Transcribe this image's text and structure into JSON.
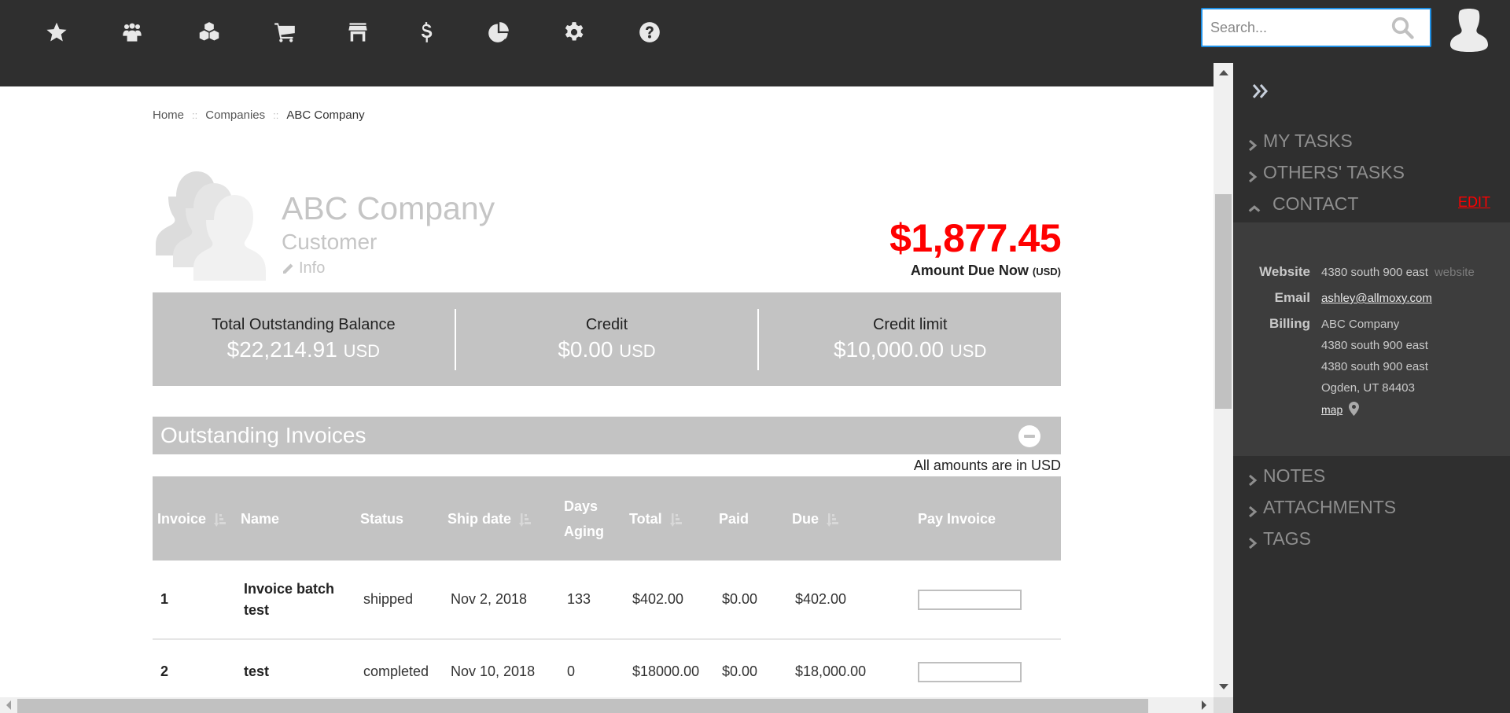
{
  "topnav": {
    "icons": [
      {
        "name": "favorites",
        "icon": "star-icon"
      },
      {
        "name": "companies",
        "icon": "users-icon"
      },
      {
        "name": "products",
        "icon": "cubes-icon"
      },
      {
        "name": "orders",
        "icon": "cart-icon"
      },
      {
        "name": "store",
        "icon": "store-icon"
      },
      {
        "name": "billing",
        "icon": "dollar-icon"
      },
      {
        "name": "reports",
        "icon": "pie-chart-icon"
      },
      {
        "name": "settings",
        "icon": "gear-icon"
      },
      {
        "name": "help",
        "icon": "question-icon"
      }
    ],
    "search": {
      "placeholder": "Search...",
      "value": ""
    }
  },
  "breadcrumb": {
    "items": [
      "Home",
      "Companies",
      "ABC Company"
    ],
    "separator": "::"
  },
  "company": {
    "name": "ABC Company",
    "type": "Customer",
    "info_label": "Info"
  },
  "amount_due": {
    "value": "$1,877.45",
    "label": "Amount Due Now",
    "currency": "(USD)",
    "color": "#ff0000"
  },
  "summary": [
    {
      "label": "Total Outstanding Balance",
      "value": "$22,214.91",
      "currency": "USD"
    },
    {
      "label": "Credit",
      "value": "$0.00",
      "currency": "USD"
    },
    {
      "label": "Credit limit",
      "value": "$10,000.00",
      "currency": "USD"
    }
  ],
  "invoices": {
    "title": "Outstanding Invoices",
    "note": "All amounts are in USD",
    "columns": [
      {
        "label": "Invoice",
        "sortable": true
      },
      {
        "label": "Name",
        "sortable": false
      },
      {
        "label": "Status",
        "sortable": false
      },
      {
        "label": "Ship date",
        "sortable": true
      },
      {
        "label": "Days Aging",
        "sortable": false
      },
      {
        "label": "Total",
        "sortable": true
      },
      {
        "label": "Paid",
        "sortable": false
      },
      {
        "label": "Due",
        "sortable": true
      },
      {
        "label": "Pay Invoice",
        "sortable": false
      }
    ],
    "rows": [
      {
        "invoice": "1",
        "name": "Invoice batch test",
        "status": "shipped",
        "ship_date": "Nov 2, 2018",
        "days_aging": "133",
        "total": "$402.00",
        "paid": "$0.00",
        "due": "$402.00",
        "pay": ""
      },
      {
        "invoice": "2",
        "name": "test",
        "status": "completed",
        "ship_date": "Nov 10, 2018",
        "days_aging": "0",
        "total": "$18000.00",
        "paid": "$0.00",
        "due": "$18,000.00",
        "pay": ""
      }
    ]
  },
  "sidebar": {
    "sections": [
      {
        "label": "MY TASKS",
        "expanded": false
      },
      {
        "label": "OTHERS' TASKS",
        "expanded": false
      },
      {
        "label": "CONTACT",
        "expanded": true
      },
      {
        "label": "NOTES",
        "expanded": false
      },
      {
        "label": "ATTACHMENTS",
        "expanded": false
      },
      {
        "label": "TAGS",
        "expanded": false
      }
    ],
    "edit_label": "EDIT",
    "contact": {
      "website_label": "Website",
      "website_value": "4380 south 900 east",
      "website_link": "website",
      "email_label": "Email",
      "email_value": "ashley@allmoxy.com",
      "billing_label": "Billing",
      "billing_lines": [
        "ABC Company",
        "4380 south 900 east",
        "4380 south 900 east",
        "Ogden, UT 84403"
      ],
      "map_label": "map"
    }
  }
}
